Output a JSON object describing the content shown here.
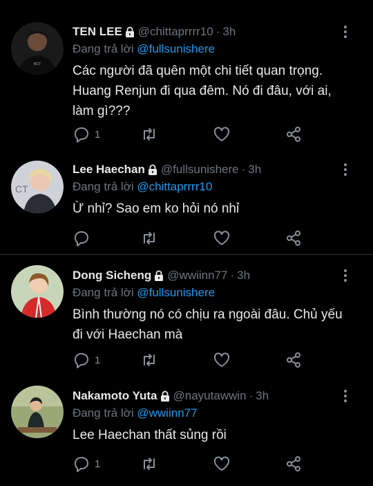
{
  "tweets": [
    {
      "name": "TEN LEE",
      "handle": "@chittaprrrr10",
      "time": "3h",
      "reply_prefix": "Đang trả lời",
      "reply_to": "@fullsunishere",
      "text": "Các người đã quên một chi tiết quan trọng. Huang Renjun đi qua đêm. Nó đi đâu, với ai, làm gì???",
      "reply_count": "1"
    },
    {
      "name": "Lee Haechan",
      "handle": "@fullsunishere",
      "time": "3h",
      "reply_prefix": "Đang trả lời",
      "reply_to": "@chittaprrrr10",
      "text": "Ừ nhỉ? Sao em ko hỏi nó nhỉ",
      "reply_count": ""
    },
    {
      "name": "Dong Sicheng",
      "handle": "@wwiinn77",
      "time": "3h",
      "reply_prefix": "Đang trả lời",
      "reply_to": "@fullsunishere",
      "text": "Bình thường nó có chịu ra ngoài đâu. Chủ yếu đi với Haechan mà",
      "reply_count": "1"
    },
    {
      "name": "Nakamoto Yuta",
      "handle": "@nayutawwin",
      "time": "3h",
      "reply_prefix": "Đang trả lời",
      "reply_to": "@wwiinn77",
      "text": "Lee Haechan thất sủng rồi",
      "reply_count": "1"
    }
  ],
  "icons": {
    "reply": "reply-icon",
    "retweet": "retweet-icon",
    "like": "heart-icon",
    "share": "share-icon",
    "more": "more-vertical-icon",
    "lock": "lock-icon"
  },
  "colors": {
    "background": "#000000",
    "text": "#e7e9ea",
    "muted": "#6e767d",
    "mention": "#1d9bf0",
    "icon": "#8b9197",
    "divider": "#2f3336"
  }
}
